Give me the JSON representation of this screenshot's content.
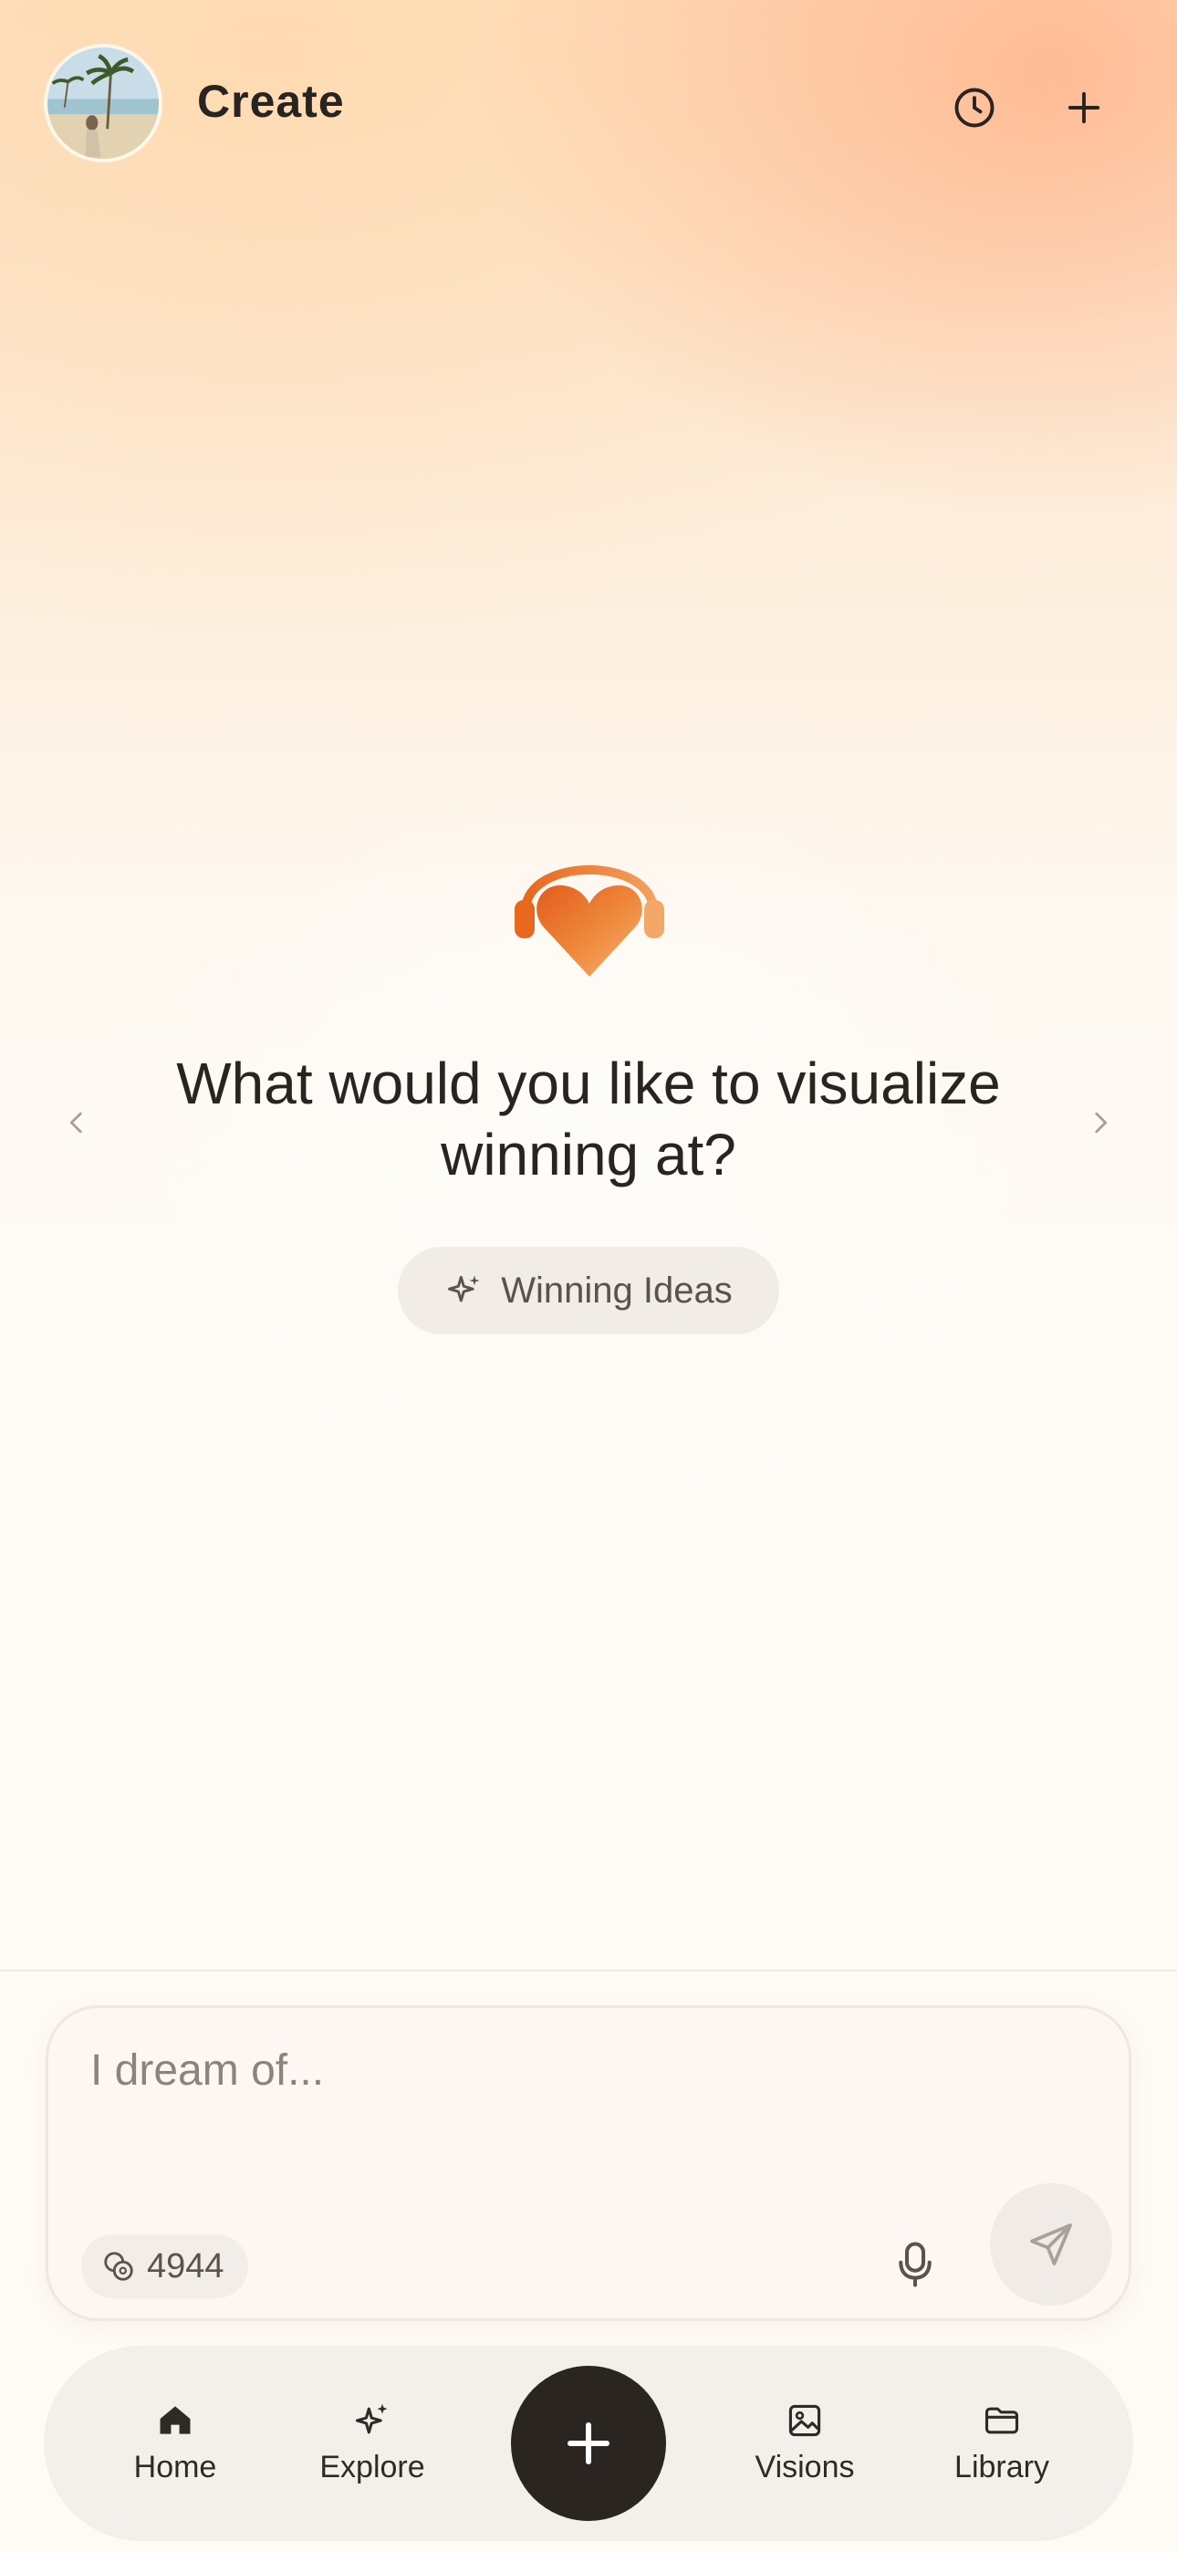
{
  "header": {
    "title": "Create",
    "avatar_icon": "user-avatar-beach-photo",
    "history_icon": "clock-icon",
    "new_icon": "plus-icon"
  },
  "hero": {
    "icon": "heart-headphones-icon",
    "question": "What would you like to visualize winning at?",
    "ideas_button_label": "Winning Ideas",
    "ideas_icon": "sparkle-icon"
  },
  "prompt": {
    "placeholder": "I dream of...",
    "value": "",
    "credits": "4944",
    "credits_icon": "coins-icon",
    "mic_icon": "microphone-icon",
    "send_icon": "send-icon"
  },
  "nav": {
    "items": [
      {
        "label": "Home",
        "icon": "home-icon"
      },
      {
        "label": "Explore",
        "icon": "sparkle-icon"
      },
      {
        "label": "Visions",
        "icon": "image-icon"
      },
      {
        "label": "Library",
        "icon": "folder-icon"
      }
    ],
    "fab_icon": "plus-icon"
  },
  "colors": {
    "accent_gradient_start": "#e8641f",
    "accent_gradient_end": "#f4a86a",
    "text_primary": "#2a2420",
    "fab_bg": "#2b2522"
  }
}
